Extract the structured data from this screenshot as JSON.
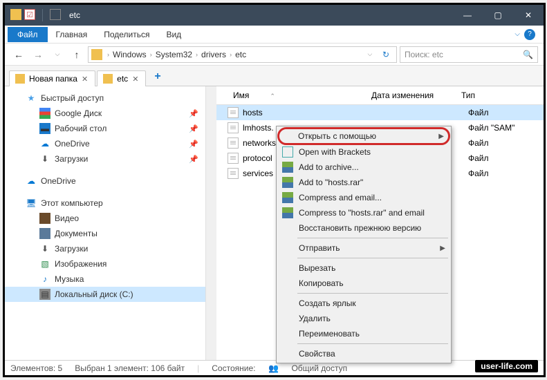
{
  "titlebar": {
    "title": "etc"
  },
  "menubar": {
    "file": "Файл",
    "items": [
      "Главная",
      "Поделиться",
      "Вид"
    ]
  },
  "path": {
    "segments": [
      "Windows",
      "System32",
      "drivers",
      "etc"
    ]
  },
  "search": {
    "placeholder": "Поиск: etc"
  },
  "tabs": [
    {
      "label": "Новая папка"
    },
    {
      "label": "etc"
    }
  ],
  "sidebar": {
    "quick_access": "Быстрый доступ",
    "quick_items": [
      {
        "label": "Google Диск",
        "pin": true
      },
      {
        "label": "Рабочий стол",
        "pin": true
      },
      {
        "label": "OneDrive",
        "pin": true
      },
      {
        "label": "Загрузки",
        "pin": true
      }
    ],
    "onedrive": "OneDrive",
    "this_pc": "Этот компьютер",
    "pc_items": [
      {
        "label": "Видео"
      },
      {
        "label": "Документы"
      },
      {
        "label": "Загрузки"
      },
      {
        "label": "Изображения"
      },
      {
        "label": "Музыка"
      },
      {
        "label": "Локальный диск (C:)"
      }
    ]
  },
  "columns": {
    "name": "Имя",
    "date": "Дата изменения",
    "type": "Тип"
  },
  "files": [
    {
      "name": "hosts",
      "type": "Файл",
      "selected": true
    },
    {
      "name": "lmhosts.",
      "type": "Файл \"SAM\""
    },
    {
      "name": "networks",
      "type": "Файл"
    },
    {
      "name": "protocol",
      "type": "Файл"
    },
    {
      "name": "services",
      "type": "Файл"
    }
  ],
  "context_menu": {
    "open_with": "Открыть с помощью",
    "brackets": "Open with Brackets",
    "add_archive": "Add to archive...",
    "add_hosts_rar": "Add to \"hosts.rar\"",
    "compress_email": "Compress and email...",
    "compress_hosts_email": "Compress to \"hosts.rar\" and email",
    "restore_prev": "Восстановить прежнюю версию",
    "send_to": "Отправить",
    "cut": "Вырезать",
    "copy": "Копировать",
    "create_shortcut": "Создать ярлык",
    "delete": "Удалить",
    "rename": "Переименовать",
    "properties": "Свойства"
  },
  "statusbar": {
    "elements": "Элементов: 5",
    "selected": "Выбран 1 элемент: 106 байт",
    "state_label": "Состояние:",
    "shared": "Общий доступ"
  },
  "watermark": "user-life.com"
}
